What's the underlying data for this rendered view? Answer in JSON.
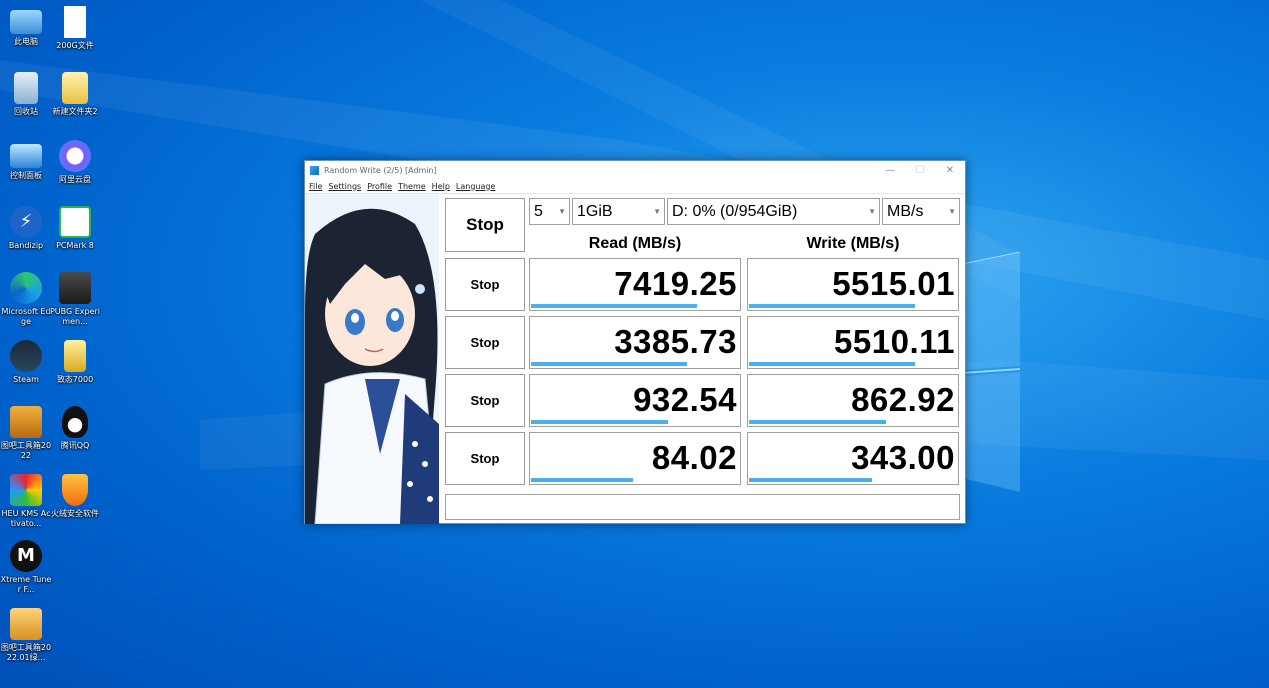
{
  "desktop": {
    "icons": [
      {
        "label": "此电脑"
      },
      {
        "label": "200G文件"
      },
      {
        "label": "回收站"
      },
      {
        "label": "新建文件夹2"
      },
      {
        "label": "控制面板"
      },
      {
        "label": "阿里云盘"
      },
      {
        "label": "Bandizip"
      },
      {
        "label": "PCMark 8"
      },
      {
        "label": "Microsoft Edge"
      },
      {
        "label": "PUBG Experimen..."
      },
      {
        "label": "Steam"
      },
      {
        "label": "致态7000"
      },
      {
        "label": "图吧工具箱2022"
      },
      {
        "label": "腾讯QQ"
      },
      {
        "label": "HEU KMS Activato..."
      },
      {
        "label": "火绒安全软件"
      },
      {
        "label": "Xtreme Tuner F..."
      },
      {
        "label": "图吧工具箱2022.01绿..."
      }
    ]
  },
  "window": {
    "title": "Random Write (2/5) [Admin]",
    "controls": {
      "minimize": "—",
      "maximize": "☐",
      "close": "✕"
    },
    "menu": [
      "File",
      "Settings",
      "Profile",
      "Theme",
      "Help",
      "Language"
    ],
    "main_button": "Stop",
    "selectors": {
      "count": "5",
      "size": "1GiB",
      "drive": "D: 0% (0/954GiB)",
      "unit": "MB/s"
    },
    "headers": {
      "read": "Read (MB/s)",
      "write": "Write (MB/s)"
    },
    "rows": [
      {
        "button": "Stop",
        "read": "7419.25",
        "write": "5515.01",
        "read_fill": 0.8,
        "write_fill": 0.8
      },
      {
        "button": "Stop",
        "read": "3385.73",
        "write": "5510.11",
        "read_fill": 0.75,
        "write_fill": 0.8
      },
      {
        "button": "Stop",
        "read": "932.54",
        "write": "862.92",
        "read_fill": 0.66,
        "write_fill": 0.66
      },
      {
        "button": "Stop",
        "read": "84.02",
        "write": "343.00",
        "read_fill": 0.49,
        "write_fill": 0.59
      }
    ],
    "status": ""
  },
  "colors": {
    "accent_bar": "#48b0ea",
    "desktop_blue": "#0a7ee0"
  }
}
